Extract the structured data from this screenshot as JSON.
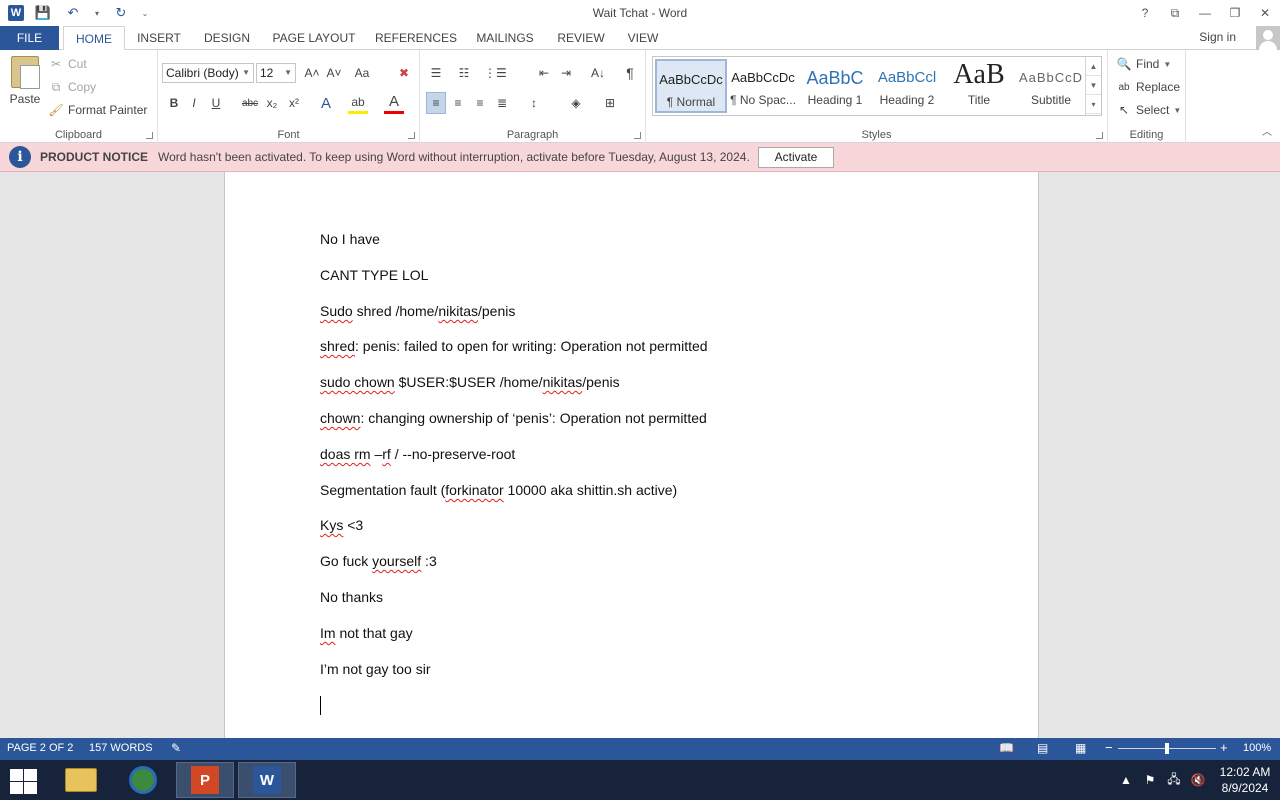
{
  "window": {
    "title": "Wait Tchat - Word",
    "help": "?",
    "restore_ribbon": "⧉",
    "minimize": "—",
    "maximize": "❐",
    "close": "✕"
  },
  "qat": {
    "app_icon": "W",
    "save": "💾",
    "undo": "↶",
    "redo": "↻",
    "more": "▾",
    "customize": "⌄"
  },
  "tabs": [
    "FILE",
    "HOME",
    "INSERT",
    "DESIGN",
    "PAGE LAYOUT",
    "REFERENCES",
    "MAILINGS",
    "REVIEW",
    "VIEW"
  ],
  "account": {
    "sign_in": "Sign in"
  },
  "clipboard": {
    "paste": "Paste",
    "cut": "Cut",
    "copy": "Copy",
    "format_painter": "Format Painter",
    "label": "Clipboard"
  },
  "font": {
    "family": "Calibri (Body)",
    "size": "12",
    "grow": "A˄",
    "shrink": "A˅",
    "case": "Aa",
    "clear": "✖",
    "bold": "B",
    "italic": "I",
    "underline": "U",
    "strike": "abc",
    "sub": "x₂",
    "sup": "x²",
    "effects": "A",
    "highlight": "ab",
    "color": "A",
    "label": "Font"
  },
  "paragraph": {
    "label": "Paragraph",
    "show_marks": "¶",
    "sort": "A↓"
  },
  "styles": {
    "label": "Styles",
    "items": [
      {
        "sample": "AaBbCcDc",
        "name": "¶ Normal"
      },
      {
        "sample": "AaBbCcDc",
        "name": "¶ No Spac..."
      },
      {
        "sample": "AaBbC",
        "name": "Heading 1"
      },
      {
        "sample": "AaBbCcl",
        "name": "Heading 2"
      },
      {
        "sample": "AaB",
        "name": "Title"
      },
      {
        "sample": "AaBbCcD",
        "name": "Subtitle"
      }
    ]
  },
  "editing": {
    "find": "Find",
    "replace": "Replace",
    "select": "Select",
    "label": "Editing"
  },
  "notice": {
    "title": "PRODUCT NOTICE",
    "text": "Word hasn't been activated. To keep using Word without interruption, activate before Tuesday, August 13, 2024.",
    "button": "Activate"
  },
  "document": {
    "paragraphs": [
      "No I have",
      "CANT TYPE LOL",
      "Sudo shred /home/nikitas/penis",
      "shred: penis: failed to open for writing: Operation not permitted",
      "sudo chown $USER:$USER /home/nikitas/penis",
      "chown: changing ownership of ‘penis’: Operation not permitted",
      "doas rm –rf / --no-preserve-root",
      "Segmentation fault (forkinator 10000 aka shittin.sh active)",
      "Kys <3",
      "Go fuck yourself :3",
      "No thanks",
      "Im not that gay",
      "I’m not gay too sir"
    ]
  },
  "status": {
    "page": "PAGE 2 OF 2",
    "words": "157 WORDS",
    "zoom": "100%",
    "zoom_level_percent": 100
  },
  "taskbar": {
    "time": "12:02 AM",
    "date": "8/9/2024"
  }
}
